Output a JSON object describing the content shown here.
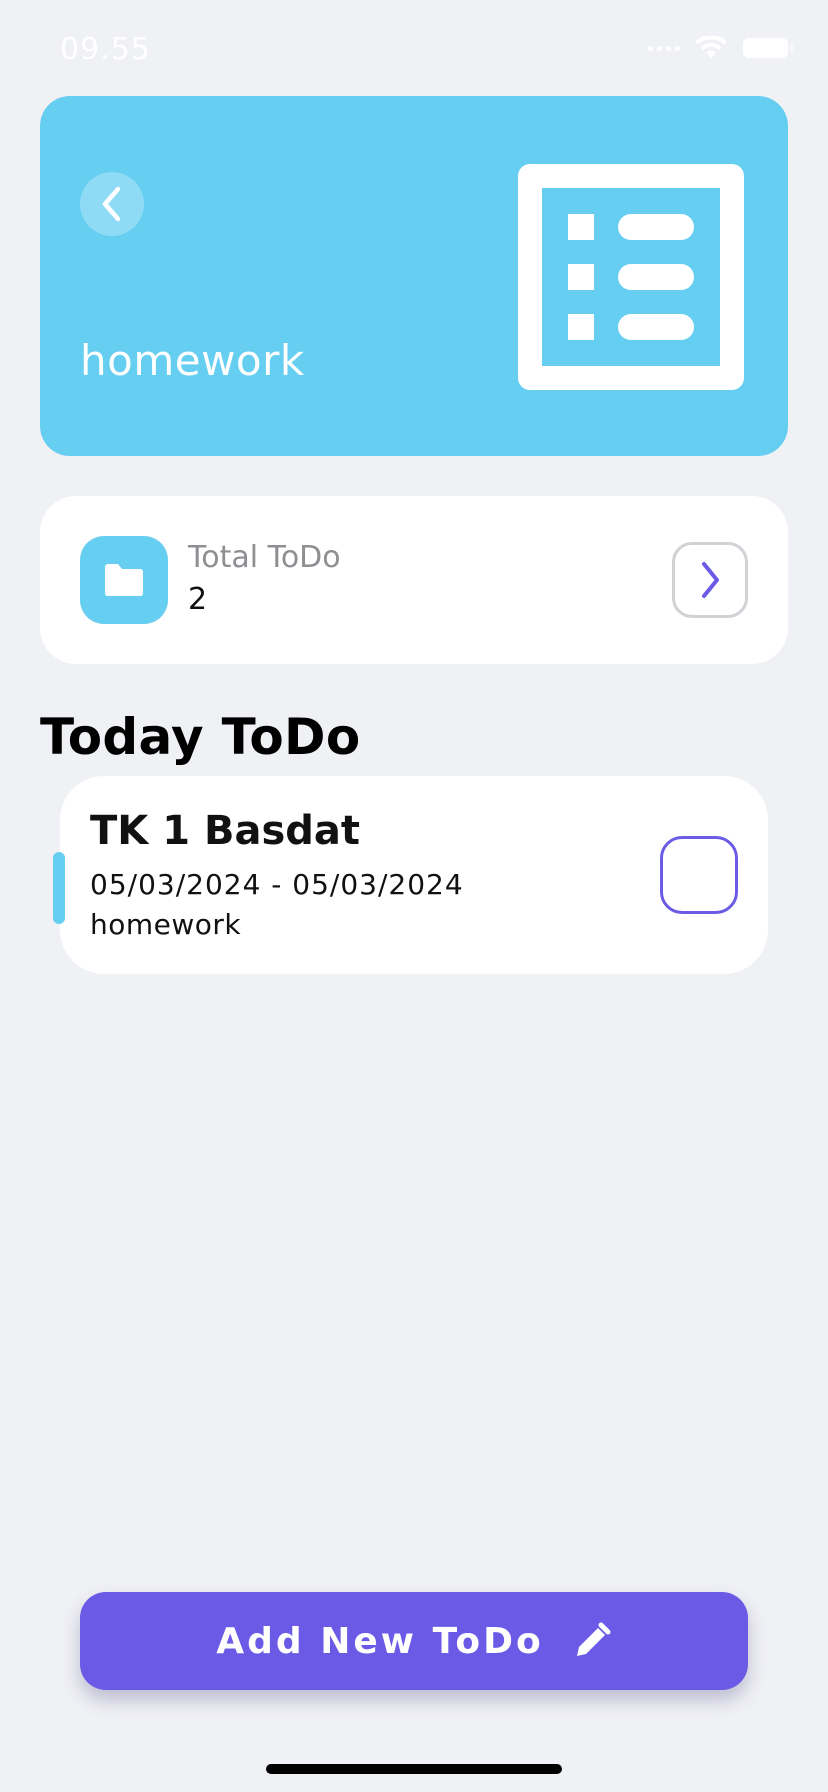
{
  "status_bar": {
    "time": "09.55"
  },
  "header": {
    "title": "homework",
    "back_icon": "chevron-left-icon",
    "illustration_icon": "list-icon"
  },
  "summary": {
    "label": "Total ToDo",
    "count": "2",
    "folder_icon": "folder-icon",
    "arrow_icon": "chevron-right-icon"
  },
  "section": {
    "title": "Today ToDo"
  },
  "todos": [
    {
      "title": "TK 1 Basdat",
      "dates": "05/03/2024 - 05/03/2024",
      "category": "homework",
      "checked": false
    }
  ],
  "actions": {
    "add_label": "Add New ToDo",
    "add_icon": "pencil-icon"
  },
  "colors": {
    "accent_blue": "#65CEF1",
    "accent_purple": "#6A5AE6",
    "background": "#F0F1F5"
  }
}
